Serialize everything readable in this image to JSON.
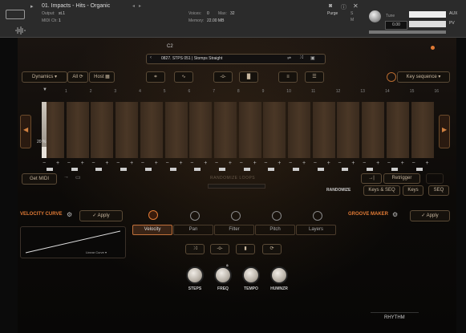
{
  "header": {
    "instrument_name": "01. Impacts - Hits - Organic",
    "output_label": "Output:",
    "output_value": "st.1",
    "midi_label": "MIDI Ch:",
    "midi_value": "1",
    "voices_label": "Voices:",
    "voices_value": "0",
    "max_label": "Max:",
    "max_value": "32",
    "memory_label": "Memory:",
    "memory_value": "22.00 MB",
    "purge_label": "Purge",
    "tune_label": "Tune",
    "tune_value": "0.00",
    "s_label": "S",
    "m_label": "M",
    "aux_label": "AUX",
    "pv_label": "PV"
  },
  "preset_bar": {
    "note_label": "C2",
    "preset_name": "0827. STPS 051 | Stomps Straight"
  },
  "toolbar": {
    "dynamics_label": "Dynamics",
    "all_label": "All",
    "host_label": "Host",
    "key_sequence_label": "Key sequence"
  },
  "sequencer": {
    "step_numbers": [
      "1",
      "2",
      "3",
      "4",
      "5",
      "6",
      "7",
      "8",
      "9",
      "10",
      "11",
      "12",
      "13",
      "14",
      "15",
      "16"
    ],
    "first_step_value": "20 %",
    "steps": [
      0.2,
      0,
      0,
      0,
      0,
      0,
      0,
      0,
      0,
      0,
      0,
      0,
      0,
      0,
      0,
      0
    ]
  },
  "sequence_row": {
    "get_midi_label": "Get MIDI",
    "random_label": "RANDOMIZE LOOPS",
    "retrigger_label": "Retrigger",
    "randomize_label": "RANDOMIZE",
    "keys_seq_label": "Keys & SEQ",
    "keys_label": "Keys",
    "seq_label": "SEQ"
  },
  "velocity": {
    "title": "VELOCITY CURVE",
    "apply_label": "Apply",
    "curve_label": "Linear Curve"
  },
  "groove": {
    "title": "GROOVE MAKER",
    "apply_label": "Apply"
  },
  "tabs": [
    "Velocity",
    "Pan",
    "Filter",
    "Pitch",
    "Layers"
  ],
  "knobs": [
    "STEPS",
    "FREQ",
    "TEMPO",
    "HUMNZR"
  ],
  "footer": {
    "rhythm_label": "RHYTHM"
  }
}
